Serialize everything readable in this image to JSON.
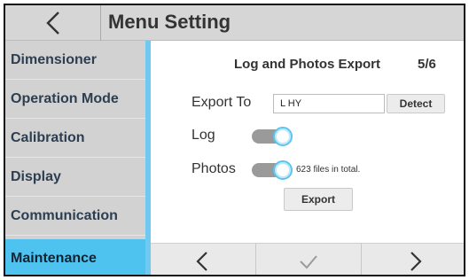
{
  "header": {
    "title": "Menu Setting",
    "back_icon": "chevron-left-icon"
  },
  "sidebar": {
    "items": [
      {
        "label": "Dimensioner"
      },
      {
        "label": "Operation Mode"
      },
      {
        "label": "Calibration"
      },
      {
        "label": "Display"
      },
      {
        "label": "Communication"
      },
      {
        "label": "Maintenance",
        "active": true
      }
    ]
  },
  "panel": {
    "title": "Log and Photos Export",
    "page": "5/6",
    "export_to_label": "Export To",
    "export_to_value": "L HY",
    "detect_label": "Detect",
    "log_label": "Log",
    "log_enabled": true,
    "photos_label": "Photos",
    "photos_enabled": true,
    "photos_note": "623 files in total.",
    "export_label": "Export"
  },
  "navbar": {
    "prev_icon": "chevron-left-icon",
    "confirm_icon": "check-icon",
    "next_icon": "chevron-right-icon"
  },
  "colors": {
    "accent": "#4fc3ef",
    "toggle_track": "#9a9a9a",
    "sidebar_bg": "#d2d2d2",
    "header_bg": "#d6d6d6"
  }
}
